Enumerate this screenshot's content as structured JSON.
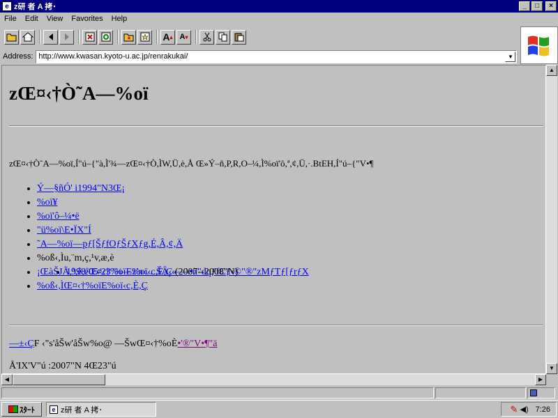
{
  "window": {
    "title": "z研 者 A 拷･",
    "caption_buttons": [
      "_",
      "□",
      "×"
    ]
  },
  "menu": [
    "File",
    "Edit",
    "View",
    "Favorites",
    "Help"
  ],
  "address": {
    "label": "Address:",
    "url": "http://www.kwasan.kyoto-u.ac.jp/renrakukai/"
  },
  "page": {
    "heading": "zŒ¤‹†Ò˜A—%oï",
    "intro": "zŒ¤‹†Ò˜A—%oï,Í\"ú–{\"à,Ì'¾—zŒ¤‹†Ò,ÌW,Ü,è,Å Œ»Ý–ñ,P,R,O–¼,Ì%oï'ô,ª,¢,Ü,·.BtEH,Í\"ú–{\"V•¶",
    "nav": [
      {
        "text": "Ý—§ñÓ' i1994\"N3Œ¡",
        "visited": false
      },
      {
        "text": "%oï¥",
        "visited": false
      },
      {
        "text": "%oï'ô–¼•ë",
        "visited": false
      },
      {
        "text": "\"ü%oï\\E•ÏX\"Í",
        "visited": false
      },
      {
        "text": "˜A—%oï—pƒ[ŠƒfOƒŠƒXƒg,É,Â,¢,Ä",
        "visited": false
      }
    ],
    "history": {
      "text": "%oß‹,Ìu,¨m,ç,¹v,æ,è",
      "items": [
        {
          "text": "1998/05/23 '¾—z'n‹…ŠÂ‹«—\\•ñ\"dqƒfCƒ‹©\"®\"zMƒTƒ[ƒrƒX"
        }
      ]
    },
    "report": {
      "link": "¡ŒàŠJÃ,³,ê,éŒ¤‹†%oïE%oï‹c,È,Ç",
      "suffix": " (2007--2008\"N)"
    },
    "past": {
      "link": "%oß‹,ÌŒ¤‹†%oïE%oï‹c,È,Ç"
    },
    "contact": {
      "link": "—±‹Ç",
      "text": "F ‹\"s'åŠw'åŠw%o@ —ŠwŒ¤‹†%oÈ",
      "visited_link": "•'®\"V•¶\"ä"
    },
    "updated": "Å'IX'V\"ú :2007\"N 4Œ23\"ú"
  },
  "taskbar": {
    "start": "ｽﾀｰﾄ",
    "task": "z研 者 A 拷･",
    "clock": "7:26"
  },
  "colors": {
    "titlebar": "#000080",
    "link": "#0000ee",
    "visited": "#800080",
    "face": "#c0c0c0"
  }
}
